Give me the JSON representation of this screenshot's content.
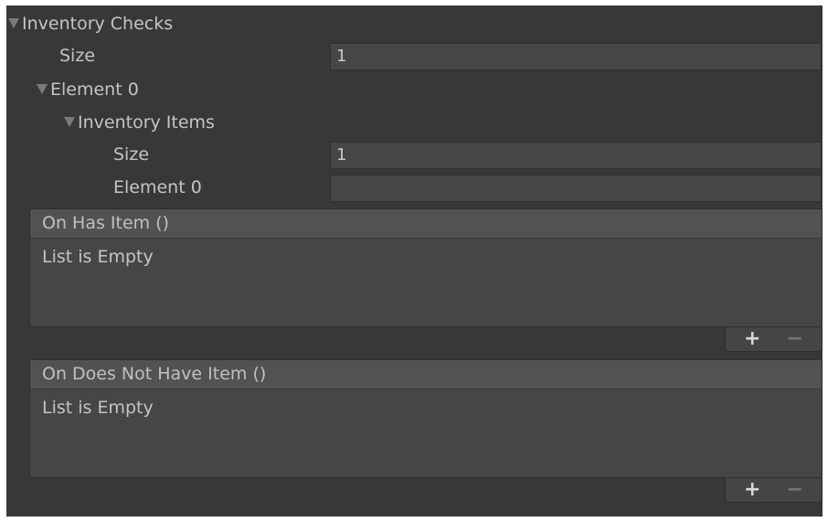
{
  "inventory_checks": {
    "label": "Inventory Checks",
    "size_label": "Size",
    "size_value": "1",
    "element0": {
      "label": "Element 0",
      "inventory_items": {
        "label": "Inventory Items",
        "size_label": "Size",
        "size_value": "1",
        "element0_label": "Element 0",
        "element0_value": ""
      }
    }
  },
  "events": [
    {
      "header": "On Has Item ()",
      "body": "List is Empty",
      "add": "+",
      "remove": "−"
    },
    {
      "header": "On Does Not Have Item ()",
      "body": "List is Empty",
      "add": "+",
      "remove": "−"
    }
  ],
  "icons": {
    "foldout": "triangle-down-icon"
  },
  "colors": {
    "background": "#383838",
    "field": "#464646",
    "header": "#525252",
    "text": "#c4c4c4"
  }
}
